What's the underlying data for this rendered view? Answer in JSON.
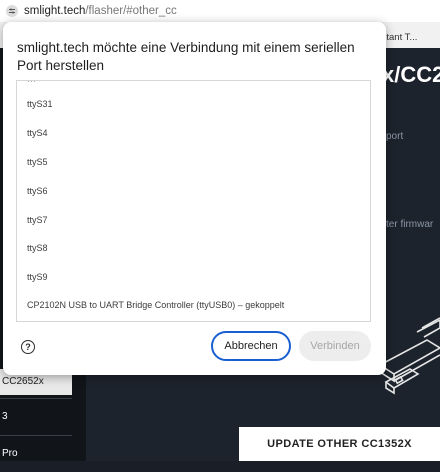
{
  "browser": {
    "host": "smlight.tech",
    "path": "/flasher/#other_cc",
    "tab_fragment": "ssistant T..."
  },
  "background_page": {
    "heading": "x/CC2",
    "text_support": "port",
    "text_firmware": "ter firmwar",
    "sidebar_items": [
      "CC2652x",
      "3",
      "Pro"
    ],
    "update_button": "UPDATE OTHER CC1352X"
  },
  "dialog": {
    "title": "smlight.tech möchte eine Verbindung mit einem seriellen Port herstellen",
    "ports": [
      "ttyS31",
      "ttyS4",
      "ttyS5",
      "ttyS6",
      "ttyS7",
      "ttyS8",
      "ttyS9",
      "CP2102N USB to UART Bridge Controller (ttyUSB0) – gekoppelt"
    ],
    "help_glyph": "?",
    "cancel_label": "Abbrechen",
    "connect_label": "Verbinden"
  },
  "colors": {
    "accent": "#1a5fd1",
    "page_dark": "#1d232c",
    "sidebar_dark": "#11151a"
  },
  "icons": {
    "site_info": "site-settings-icon",
    "help": "help-icon"
  }
}
